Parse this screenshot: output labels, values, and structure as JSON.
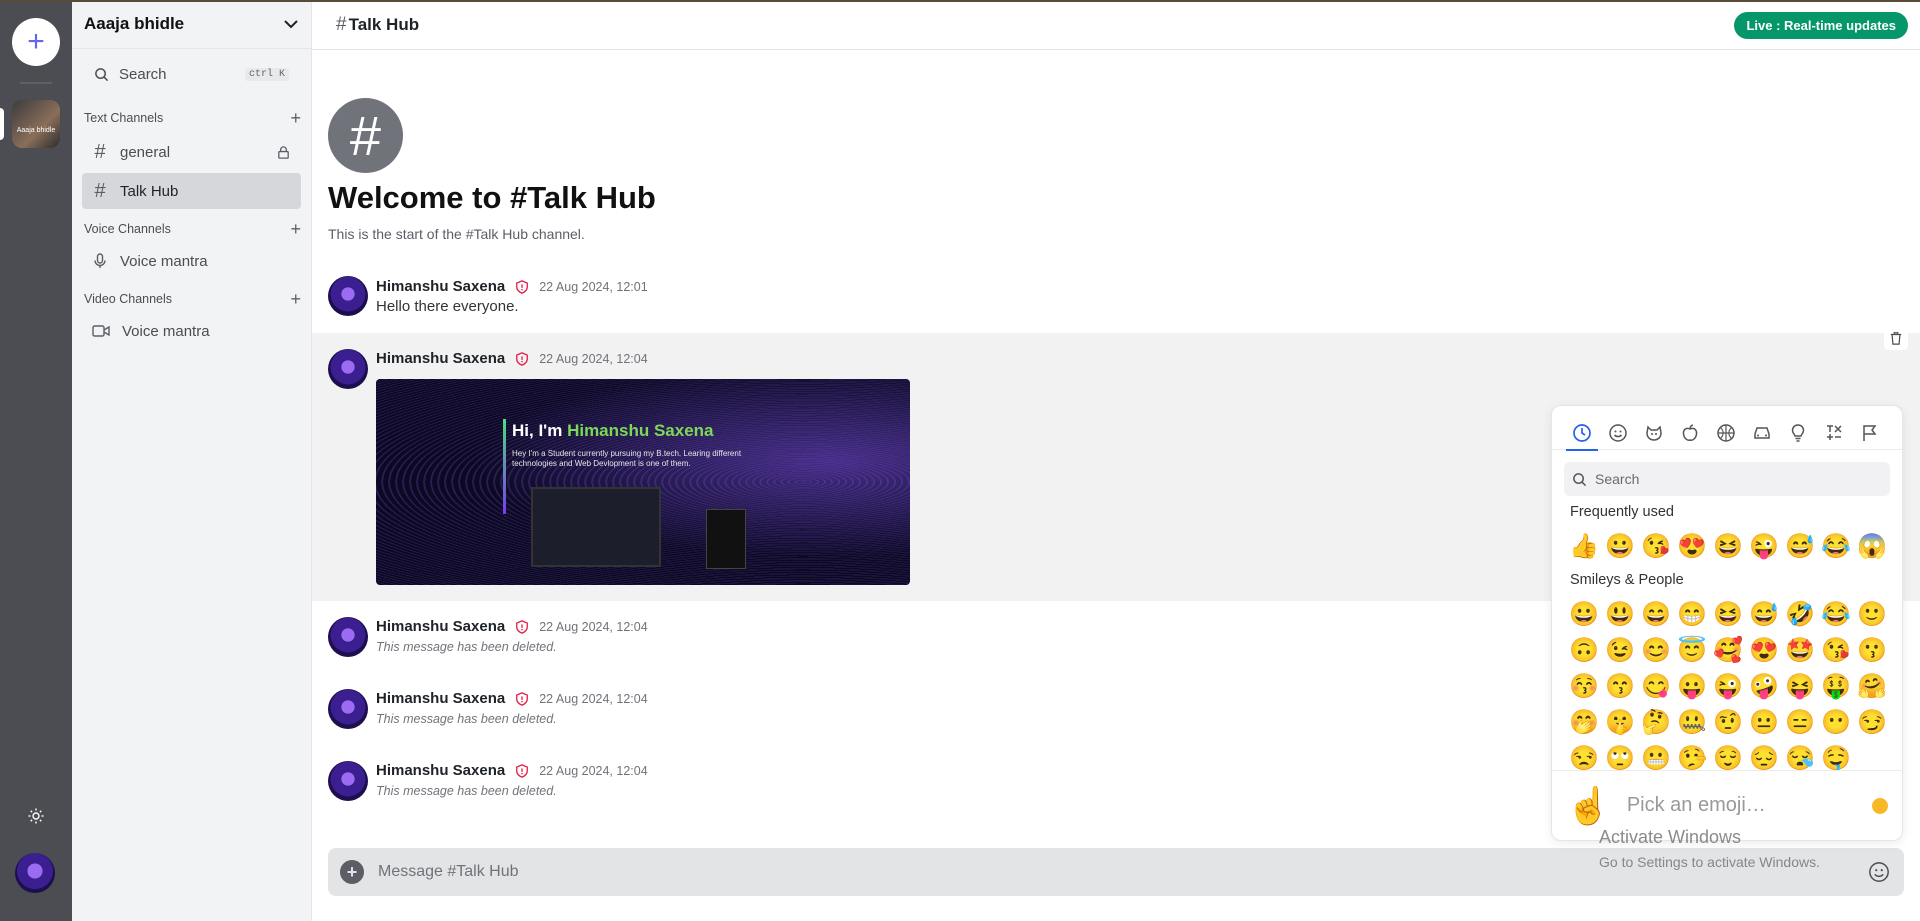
{
  "server": {
    "name": "Aaaja bhidle",
    "icon_label": "Aaaja bhidle"
  },
  "search": {
    "label": "Search",
    "shortcut": "ctrl K"
  },
  "sections": {
    "text": {
      "title": "Text Channels",
      "channels": [
        {
          "name": "general"
        },
        {
          "name": "Talk Hub"
        }
      ]
    },
    "voice": {
      "title": "Voice Channels",
      "channels": [
        {
          "name": "Voice mantra"
        }
      ]
    },
    "video": {
      "title": "Video Channels",
      "channels": [
        {
          "name": "Voice mantra"
        }
      ]
    }
  },
  "header": {
    "channel": "Talk Hub",
    "live": "Live : Real-time updates"
  },
  "welcome": {
    "title": "Welcome to #Talk Hub",
    "subtitle": "This is the start of the #Talk Hub channel."
  },
  "messages": [
    {
      "author": "Himanshu Saxena",
      "time": "22 Aug 2024, 12:01",
      "content": "Hello there everyone."
    },
    {
      "author": "Himanshu Saxena",
      "time": "22 Aug 2024, 12:04",
      "attachment": {
        "greeting": "Hi, I'm",
        "name": "Himanshu Saxena",
        "text": "Hey I'm a Student currently pursuing my B.tech. Learing different technologies and Web Devlopment is one of them."
      }
    },
    {
      "author": "Himanshu Saxena",
      "time": "22 Aug 2024, 12:04",
      "deleted": "This message has been deleted."
    },
    {
      "author": "Himanshu Saxena",
      "time": "22 Aug 2024, 12:04",
      "deleted": "This message has been deleted."
    },
    {
      "author": "Himanshu Saxena",
      "time": "22 Aug 2024, 12:04",
      "deleted": "This message has been deleted."
    }
  ],
  "composer": {
    "placeholder": "Message #Talk Hub"
  },
  "picker": {
    "search_placeholder": "Search",
    "frequent_title": "Frequently used",
    "frequent": [
      "👍",
      "😀",
      "😘",
      "😍",
      "😆",
      "😜",
      "😅",
      "😂",
      "😱"
    ],
    "smileys_title": "Smileys & People",
    "smileys": [
      "😀",
      "😃",
      "😄",
      "😁",
      "😆",
      "😅",
      "🤣",
      "😂",
      "🙂",
      "🙃",
      "😉",
      "😊",
      "😇",
      "🥰",
      "😍",
      "🤩",
      "😘",
      "😗",
      "😚",
      "😙",
      "😋",
      "😛",
      "😜",
      "🤪",
      "😝",
      "🤑",
      "🤗",
      "🤭",
      "🤫",
      "🤔",
      "🤐",
      "🤨",
      "😐",
      "😑",
      "😶",
      "😏",
      "😒",
      "🙄",
      "😬",
      "🤥",
      "😌",
      "😔",
      "😪",
      "🤤"
    ],
    "footer_hand": "☝️",
    "footer_text": "Pick an emoji…"
  },
  "watermark": {
    "title": "Activate Windows",
    "subtitle": "Go to Settings to activate Windows."
  },
  "colors": {
    "accent": "#6366f1",
    "live": "#059669",
    "rail": "#4b4d52",
    "sidebar": "#f2f3f5"
  }
}
